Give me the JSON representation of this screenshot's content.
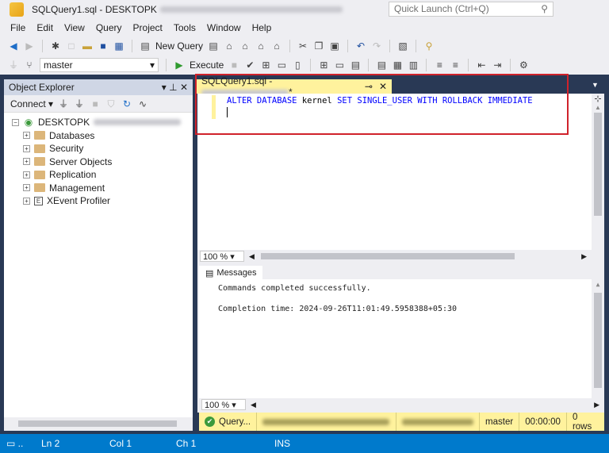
{
  "window": {
    "title": "SQLQuery1.sql - DESKTOPK",
    "quick_launch": "Quick Launch (Ctrl+Q)"
  },
  "menu": [
    "File",
    "Edit",
    "View",
    "Query",
    "Project",
    "Tools",
    "Window",
    "Help"
  ],
  "toolbar": {
    "new_query": "New Query",
    "database": "master",
    "execute": "Execute"
  },
  "object_explorer": {
    "title": "Object Explorer",
    "connect": "Connect",
    "server": "DESKTOPK",
    "items": [
      "Databases",
      "Security",
      "Server Objects",
      "Replication",
      "Management",
      "XEvent Profiler"
    ]
  },
  "editor": {
    "tab_title": "SQLQuery1.sql - ",
    "code": {
      "k1": "ALTER DATABASE ",
      "id": "kernel",
      "k2": " SET SINGLE_USER WITH ROLLBACK IMMEDIATE"
    },
    "zoom": "100 %"
  },
  "messages": {
    "tab": "Messages",
    "line1": "Commands completed successfully.",
    "line2": "Completion time: 2024-09-26T11:01:49.5958388+05:30",
    "zoom": "100 %"
  },
  "query_status": {
    "state": "Query...",
    "database": "master",
    "time": "00:00:00",
    "rows": "0 rows"
  },
  "status_bar": {
    "ln": "Ln 2",
    "col": "Col 1",
    "ch": "Ch 1",
    "mode": "INS"
  }
}
